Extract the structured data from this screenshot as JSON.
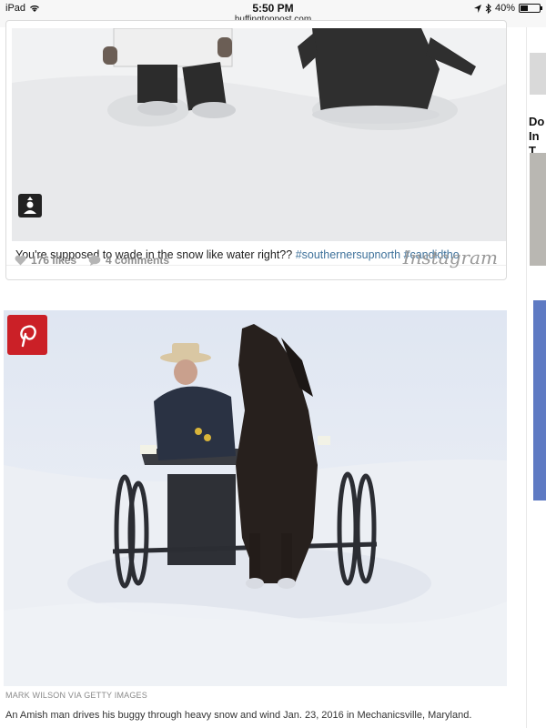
{
  "status_bar": {
    "device": "iPad",
    "time": "5:50 PM",
    "url": "huffingtonpost.com",
    "battery": "40%",
    "battery_level": 0.4,
    "icons": [
      "wifi-icon",
      "location-arrow-icon",
      "bluetooth-icon",
      "battery-icon"
    ]
  },
  "instagram_post": {
    "caption": "You're supposed to wade in the snow like water right??",
    "hashtags": "#southernersupnorth #candidtho",
    "likes": "176 likes",
    "comments": "4 comments",
    "brand": "Instagram",
    "icons": [
      "user-tag-icon",
      "heart-icon",
      "comment-icon"
    ]
  },
  "article_image": {
    "credit": "MARK WILSON VIA GETTY IMAGES",
    "caption": "An Amish man drives his buggy through heavy snow and wind Jan. 23, 2016 in Mechanicsville, Maryland.",
    "icons": [
      "pinterest-icon"
    ]
  },
  "sidebar": {
    "partial_headline": "Do\nIn T"
  },
  "colors": {
    "pinterest_red": "#cb2027",
    "hashtag_blue": "#3f729b",
    "muted_gray": "#8e8e8e",
    "rail_blue": "#5e7ac3"
  }
}
